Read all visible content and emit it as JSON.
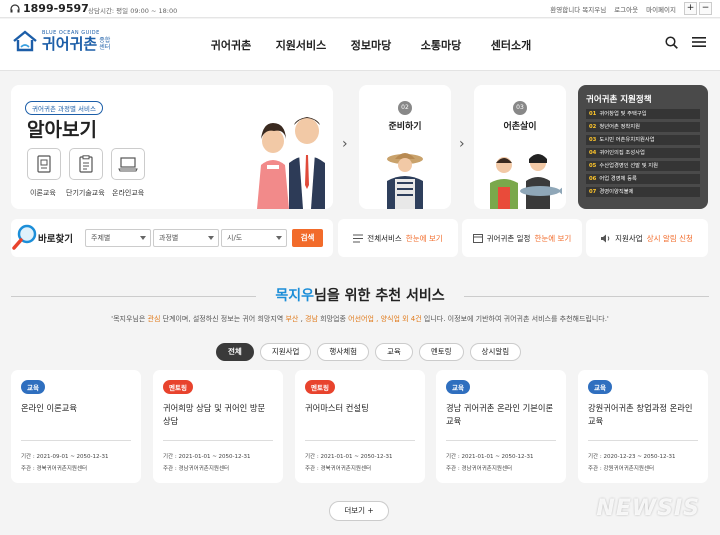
{
  "topbar": {
    "phone": "1899-9597",
    "hours": "상담시간: 평일 09:00 ~ 18:00",
    "welcome": "환영합니다 목지우님",
    "logout": "로그아웃",
    "mypage": "마이페이지",
    "zoom_in": "+",
    "zoom_out": "−"
  },
  "logo": {
    "sub": "BLUE OCEAN GUIDE",
    "main": "귀어귀촌",
    "center1": "종합",
    "center2": "센터"
  },
  "nav": [
    "귀어귀촌",
    "지원서비스",
    "정보마당",
    "소통마당",
    "센터소개"
  ],
  "hero": {
    "pill": "귀어귀촌 과정별 서비스",
    "title": "알아보기",
    "edu": [
      "이론교육",
      "단기기술교육",
      "온라인교육"
    ],
    "steps": [
      {
        "num": "02",
        "label": "준비하기"
      },
      {
        "num": "03",
        "label": "어촌살이"
      }
    ]
  },
  "policy": {
    "title": "귀어귀촌 지원정책",
    "items": [
      {
        "n": "01",
        "t": "귀어창업 및 주택구입"
      },
      {
        "n": "02",
        "t": "청년어촌 정착지원"
      },
      {
        "n": "03",
        "t": "도시민 어촌유치지원사업"
      },
      {
        "n": "04",
        "t": "귀어인의집 조성사업"
      },
      {
        "n": "05",
        "t": "수산업경영인 선발 및 지원"
      },
      {
        "n": "06",
        "t": "어업 경영체 등록"
      },
      {
        "n": "07",
        "t": "경영이양직불제"
      }
    ]
  },
  "search": {
    "label": "바로찾기",
    "sel1": "주제별",
    "sel2": "과정별",
    "sel3": "시/도",
    "button": "검색"
  },
  "quick": [
    {
      "a": "전체서비스",
      "b": "한눈에 보기"
    },
    {
      "a": "귀어귀촌 일정",
      "b": "한눈에 보기"
    },
    {
      "a": "지원사업",
      "b": "상시 알림 신청"
    }
  ],
  "rec": {
    "user": "목지우",
    "title_rest": "님을 위한 추천 서비스",
    "desc_pre": "'목지우님은 ",
    "stage": "관심",
    "desc_mid1": " 단계이며, 설정하신 정보는 귀어 희망지역 ",
    "region1": "부산",
    "sep": " , ",
    "region2": "경남",
    "desc_mid2": " 희망업종 ",
    "industry": "어선어업 , 양식업 외 4건",
    "desc_post": " 입니다. 이정보에 기반하여 귀어귀촌 서비스를 추천해드립니다.'"
  },
  "filters": [
    "전체",
    "지원사업",
    "행사체험",
    "교육",
    "멘토링",
    "상시알림"
  ],
  "cards": [
    {
      "badge": "교육",
      "title": "온라인 이론교육",
      "period_label": "기간 :",
      "period": "2021-09-01 ~ 2050-12-31",
      "host_label": "주관 :",
      "host": "경북귀어귀촌지원센터"
    },
    {
      "badge": "멘토링",
      "title": "귀어희망 상담 및 귀어인 방문 상담",
      "period_label": "기간 :",
      "period": "2021-01-01 ~ 2050-12-31",
      "host_label": "주관 :",
      "host": "경남귀어귀촌지원센터"
    },
    {
      "badge": "멘토링",
      "title": "귀어마스터 컨설팅",
      "period_label": "기간 :",
      "period": "2021-01-01 ~ 2050-12-31",
      "host_label": "주관 :",
      "host": "경북귀어귀촌지원센터"
    },
    {
      "badge": "교육",
      "title": "경남 귀어귀촌 온라인 기본이론교육",
      "period_label": "기간 :",
      "period": "2021-01-01 ~ 2050-12-31",
      "host_label": "주관 :",
      "host": "경남귀어귀촌지원센터"
    },
    {
      "badge": "교육",
      "title": "강원귀어귀촌 창업과정 온라인 교육",
      "period_label": "기간 :",
      "period": "2020-12-23 ~ 2050-12-31",
      "host_label": "주관 :",
      "host": "강원귀어귀촌지원센터"
    }
  ],
  "more": "더보기  +",
  "watermark": "NEWSIS",
  "colors": {
    "brand": "#1c5ea8",
    "accent": "#f26b2a",
    "edu_badge": "#2f6fbf",
    "mentor_badge": "#e8432d"
  }
}
